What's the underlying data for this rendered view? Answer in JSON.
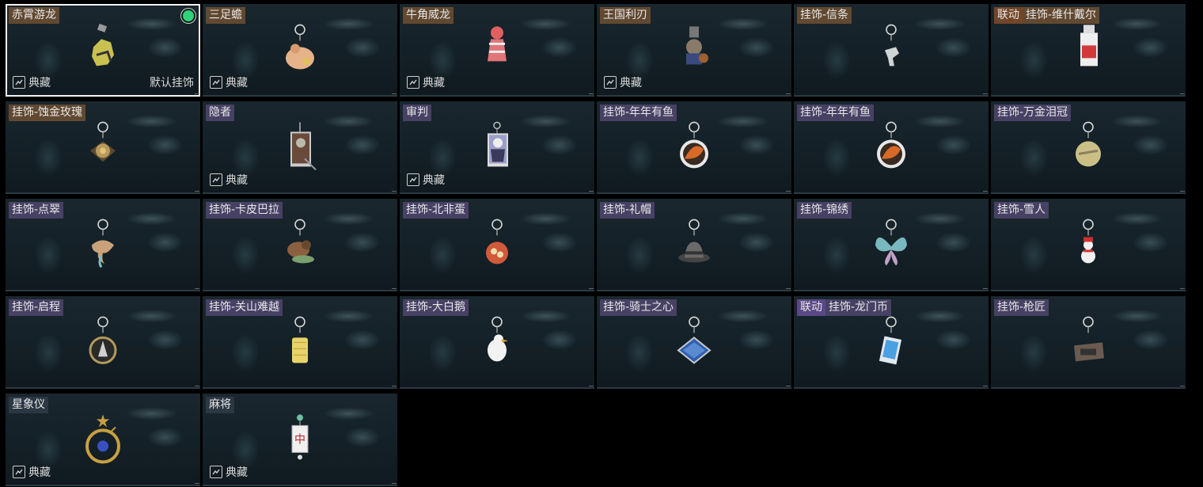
{
  "ui": {
    "collection_label": "典藏",
    "default_label": "默认挂饰"
  },
  "items": [
    {
      "tags": [
        {
          "text": "赤霄游龙",
          "style": "gold"
        }
      ],
      "collection": true,
      "default": true,
      "equipped": true,
      "selected": true,
      "icon": "dragon-charm-icon",
      "color": "#c9c050"
    },
    {
      "tags": [
        {
          "text": "三足蟾",
          "style": "gold"
        }
      ],
      "collection": true,
      "icon": "toad-charm-icon",
      "color": "#e6b28a"
    },
    {
      "tags": [
        {
          "text": "牛角威龙",
          "style": "gold"
        }
      ],
      "collection": true,
      "icon": "horned-dragon-charm-icon",
      "color": "#e0757a"
    },
    {
      "tags": [
        {
          "text": "王国利刃",
          "style": "gold"
        }
      ],
      "collection": true,
      "icon": "knight-charm-icon",
      "color": "#8a7a6a"
    },
    {
      "tags": [
        {
          "text": "挂饰-信条",
          "style": "gold"
        }
      ],
      "collection": false,
      "icon": "creed-charm-icon",
      "color": "#d0d4d6"
    },
    {
      "tags": [
        {
          "text": "联动",
          "style": "brown"
        },
        {
          "text": "挂饰-维什戴尔",
          "style": "gold"
        }
      ],
      "collection": false,
      "icon": "capsule-charm-icon",
      "color": "#d23a3a"
    },
    {
      "tags": [
        {
          "text": "挂饰-蚀金玫瑰",
          "style": "gold"
        }
      ],
      "collection": false,
      "icon": "gold-rose-charm-icon",
      "color": "#b89a5a"
    },
    {
      "tags": [
        {
          "text": "隐者",
          "style": "purple"
        }
      ],
      "collection": true,
      "icon": "hermit-card-icon",
      "color": "#6a4a3a"
    },
    {
      "tags": [
        {
          "text": "审判",
          "style": "purple"
        }
      ],
      "collection": true,
      "icon": "judgement-card-icon",
      "color": "#9aa0c8"
    },
    {
      "tags": [
        {
          "text": "挂饰-年年有鱼",
          "style": "purple"
        }
      ],
      "collection": false,
      "icon": "fish-plate-charm-icon",
      "color": "#d86a28"
    },
    {
      "tags": [
        {
          "text": "挂饰-年年有鱼",
          "style": "purple"
        }
      ],
      "collection": false,
      "icon": "fish-plate-charm-icon",
      "color": "#d86a28"
    },
    {
      "tags": [
        {
          "text": "挂饰-万金泪冠",
          "style": "purple"
        }
      ],
      "collection": false,
      "icon": "crown-charm-icon",
      "color": "#cbbf86"
    },
    {
      "tags": [
        {
          "text": "挂饰-点翠",
          "style": "purple"
        }
      ],
      "collection": false,
      "icon": "phoenix-charm-icon",
      "color": "#c9a27a"
    },
    {
      "tags": [
        {
          "text": "挂饰-卡皮巴拉",
          "style": "purple"
        }
      ],
      "collection": false,
      "icon": "capybara-charm-icon",
      "color": "#8a6040"
    },
    {
      "tags": [
        {
          "text": "挂饰-北非蛋",
          "style": "purple"
        }
      ],
      "collection": false,
      "icon": "shakshuka-charm-icon",
      "color": "#d05a3a"
    },
    {
      "tags": [
        {
          "text": "挂饰-礼帽",
          "style": "purple"
        }
      ],
      "collection": false,
      "icon": "top-hat-charm-icon",
      "color": "#6a6a6a"
    },
    {
      "tags": [
        {
          "text": "挂饰-锦绣",
          "style": "purple"
        }
      ],
      "collection": false,
      "icon": "butterfly-charm-icon",
      "color": "#7ab8c0"
    },
    {
      "tags": [
        {
          "text": "挂饰-雪人",
          "style": "purple"
        }
      ],
      "collection": false,
      "icon": "snowman-charm-icon",
      "color": "#f0f0f0"
    },
    {
      "tags": [
        {
          "text": "挂饰-启程",
          "style": "purple"
        }
      ],
      "collection": false,
      "icon": "compass-charm-icon",
      "color": "#b49a5a"
    },
    {
      "tags": [
        {
          "text": "挂饰-关山难越",
          "style": "purple"
        }
      ],
      "collection": false,
      "icon": "gold-bar-charm-icon",
      "color": "#e8d36a"
    },
    {
      "tags": [
        {
          "text": "挂饰-大白鹅",
          "style": "purple"
        }
      ],
      "collection": false,
      "icon": "goose-charm-icon",
      "color": "#f2f2f2"
    },
    {
      "tags": [
        {
          "text": "挂饰-骑士之心",
          "style": "purple"
        }
      ],
      "collection": false,
      "icon": "knight-heart-charm-icon",
      "color": "#2f5fb0"
    },
    {
      "tags": [
        {
          "text": "联动",
          "style": "violet"
        },
        {
          "text": "挂饰-龙门币",
          "style": "purple"
        }
      ],
      "collection": false,
      "icon": "coin-card-charm-icon",
      "color": "#4aa0e0"
    },
    {
      "tags": [
        {
          "text": "挂饰-枪匠",
          "style": "purple"
        }
      ],
      "collection": false,
      "icon": "gunsmith-charm-icon",
      "color": "#6a5a50"
    },
    {
      "tags": [
        {
          "text": "星象仪",
          "style": "slate"
        }
      ],
      "collection": true,
      "icon": "astrolabe-charm-icon",
      "color": "#c8a040"
    },
    {
      "tags": [
        {
          "text": "麻将",
          "style": "slate"
        }
      ],
      "collection": true,
      "icon": "mahjong-charm-icon",
      "color": "#f0f0f0"
    }
  ]
}
